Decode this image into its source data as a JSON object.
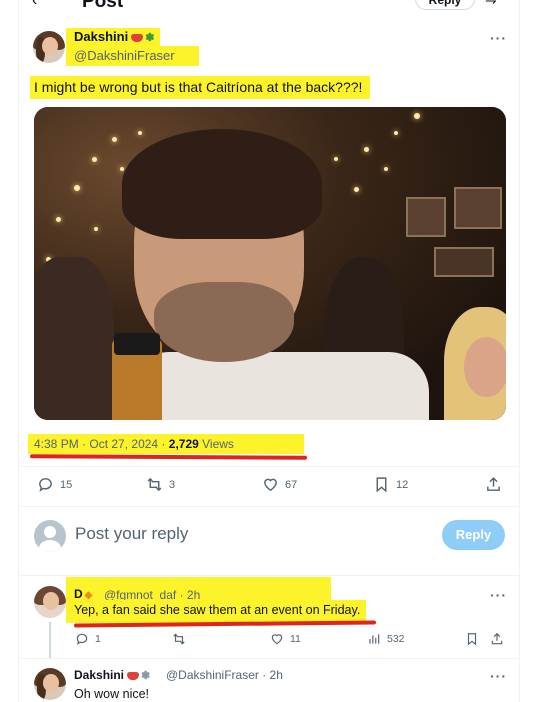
{
  "header": {
    "title": "Post",
    "reply_label": "Reply"
  },
  "post": {
    "display_name": "Dakshini",
    "handle": "@DakshiniFraser",
    "text": "I might be wrong but is that Caitríona at the back???!",
    "time": "4:38 PM",
    "date": "Oct 27, 2024",
    "views_count": "2,729",
    "views_label": "Views",
    "stats": {
      "replies": "15",
      "reposts": "3",
      "likes": "67",
      "bookmarks": "12"
    }
  },
  "composer": {
    "placeholder": "Post your reply",
    "reply_button": "Reply"
  },
  "replies": [
    {
      "display_name": "D",
      "handle": "@fgmnot_daf",
      "age": "2h",
      "text": "Yep, a fan said she saw them at an event on Friday.",
      "stats": {
        "replies": "1",
        "likes": "11",
        "views": "532"
      }
    },
    {
      "display_name": "Dakshini",
      "handle": "@DakshiniFraser",
      "age": "2h",
      "text": "Oh wow nice!"
    }
  ],
  "icons": [
    "back-arrow-icon",
    "more-icon",
    "reply-icon",
    "repost-icon",
    "like-icon",
    "bookmark-icon",
    "share-icon",
    "views-icon"
  ],
  "colors": {
    "highlight": "#fdf32a",
    "underline": "#e0241b",
    "reply_button": "#8ecdf8",
    "muted_text": "#536471"
  }
}
